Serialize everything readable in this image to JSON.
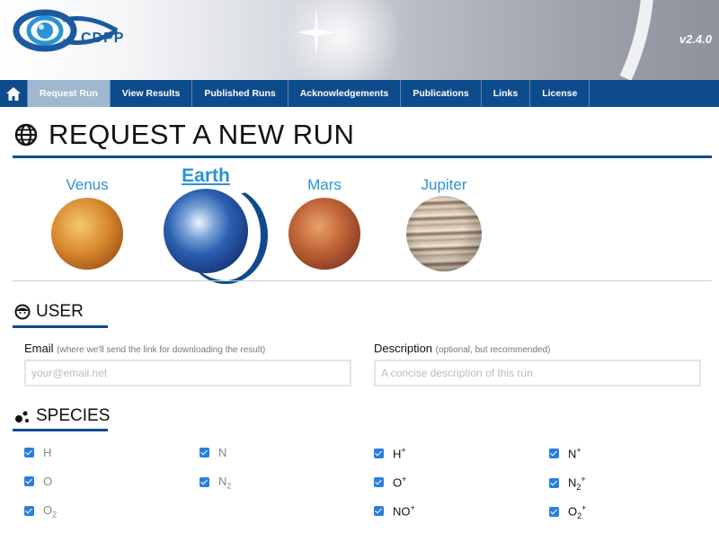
{
  "header": {
    "logo_text": "CDPP",
    "version": "v2.4.0"
  },
  "nav": {
    "items": [
      {
        "label": "Request Run",
        "active": true
      },
      {
        "label": "View Results"
      },
      {
        "label": "Published Runs"
      },
      {
        "label": "Acknowledgements"
      },
      {
        "label": "Publications"
      },
      {
        "label": "Links"
      },
      {
        "label": "License"
      }
    ],
    "home_icon": "home-icon"
  },
  "page": {
    "title": "REQUEST A NEW RUN",
    "title_icon": "globe-icon"
  },
  "planets": [
    {
      "name": "Venus"
    },
    {
      "name": "Earth",
      "selected": true
    },
    {
      "name": "Mars"
    },
    {
      "name": "Jupiter"
    }
  ],
  "user": {
    "heading": "USER",
    "email_label": "Email",
    "email_hint": "(where we'll send the link for downloading the result)",
    "email_placeholder": "your@email.net",
    "description_label": "Description",
    "description_hint": "(optional, but recommended)",
    "description_placeholder": "A concise description of this run"
  },
  "species": {
    "heading": "SPECIES",
    "items": [
      {
        "base": "H",
        "sup": "",
        "sub": "",
        "checked": true
      },
      {
        "base": "N",
        "sup": "",
        "sub": "",
        "checked": true
      },
      {
        "base": "H",
        "sup": "+",
        "sub": "",
        "checked": true
      },
      {
        "base": "N",
        "sup": "+",
        "sub": "",
        "checked": true
      },
      {
        "base": "O",
        "sup": "",
        "sub": "",
        "checked": true
      },
      {
        "base": "N",
        "sup": "",
        "sub": "2",
        "checked": true
      },
      {
        "base": "O",
        "sup": "+",
        "sub": "",
        "checked": true
      },
      {
        "base": "N",
        "sup": "+",
        "sub": "2",
        "checked": true
      },
      {
        "base": "O",
        "sup": "",
        "sub": "2",
        "checked": true
      },
      {
        "base": "NO",
        "sup": "+",
        "sub": "",
        "checked": true
      },
      {
        "base": "O",
        "sup": "+",
        "sub": "2",
        "checked": true
      }
    ]
  },
  "colors": {
    "brand": "#0e4b8c",
    "link": "#2a93d4",
    "checkbox": "#2a7ee0",
    "nav_active": "#9fb8cf"
  }
}
